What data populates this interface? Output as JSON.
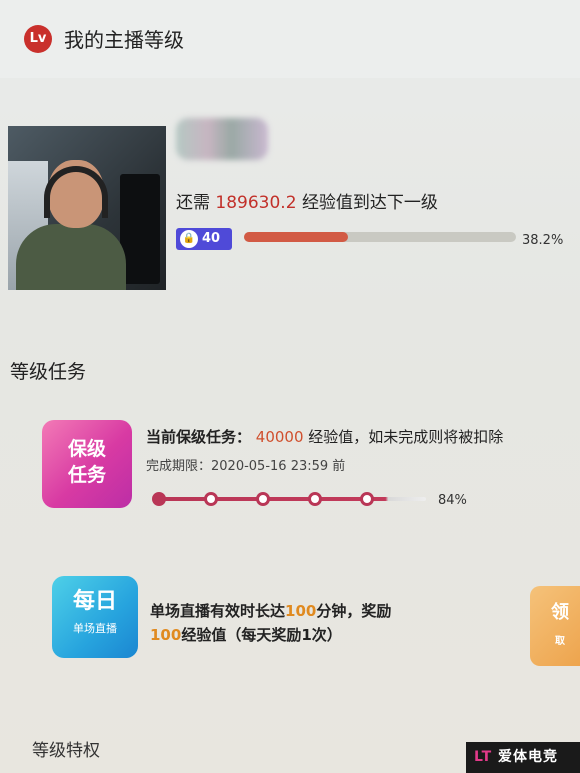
{
  "header": {
    "badge": "Lv",
    "title": "我的主播等级"
  },
  "profile": {
    "exp_prefix": "还需",
    "exp_needed": "189630.2",
    "exp_suffix": "经验值到达下一级",
    "level": "40",
    "progress_label": "38.2%",
    "progress_fraction": 0.382
  },
  "tasks": {
    "section_title": "等级任务",
    "keep_level": {
      "icon_line1": "保级",
      "icon_line2": "任务",
      "label": "当前保级任务：",
      "exp_value": "40000",
      "exp_rest": "经验值，如未完成则将被扣除",
      "deadline_label": "完成期限：",
      "deadline_value": "2020-05-16 23:59 前",
      "progress_label": "84%",
      "progress_fraction": 0.84
    },
    "daily": {
      "icon_big": "每日",
      "icon_small": "单场直播",
      "line1_a": "单场直播有效时长达",
      "line1_num": "100",
      "line1_b": "分钟，奖励",
      "line2_num": "100",
      "line2_b": "经验值（每天奖励1次）",
      "claim_label": "领",
      "claim_sub": "取"
    }
  },
  "privileges": {
    "section_title": "等级特权"
  },
  "watermark": {
    "logo": "LT",
    "text": "爱体电竞"
  },
  "colors": {
    "accent_red": "#c2302a",
    "level_badge": "#4f4ad8",
    "task_pink": "#d83aa3",
    "daily_blue": "#27a4de",
    "claim_orange": "#eda24a"
  }
}
